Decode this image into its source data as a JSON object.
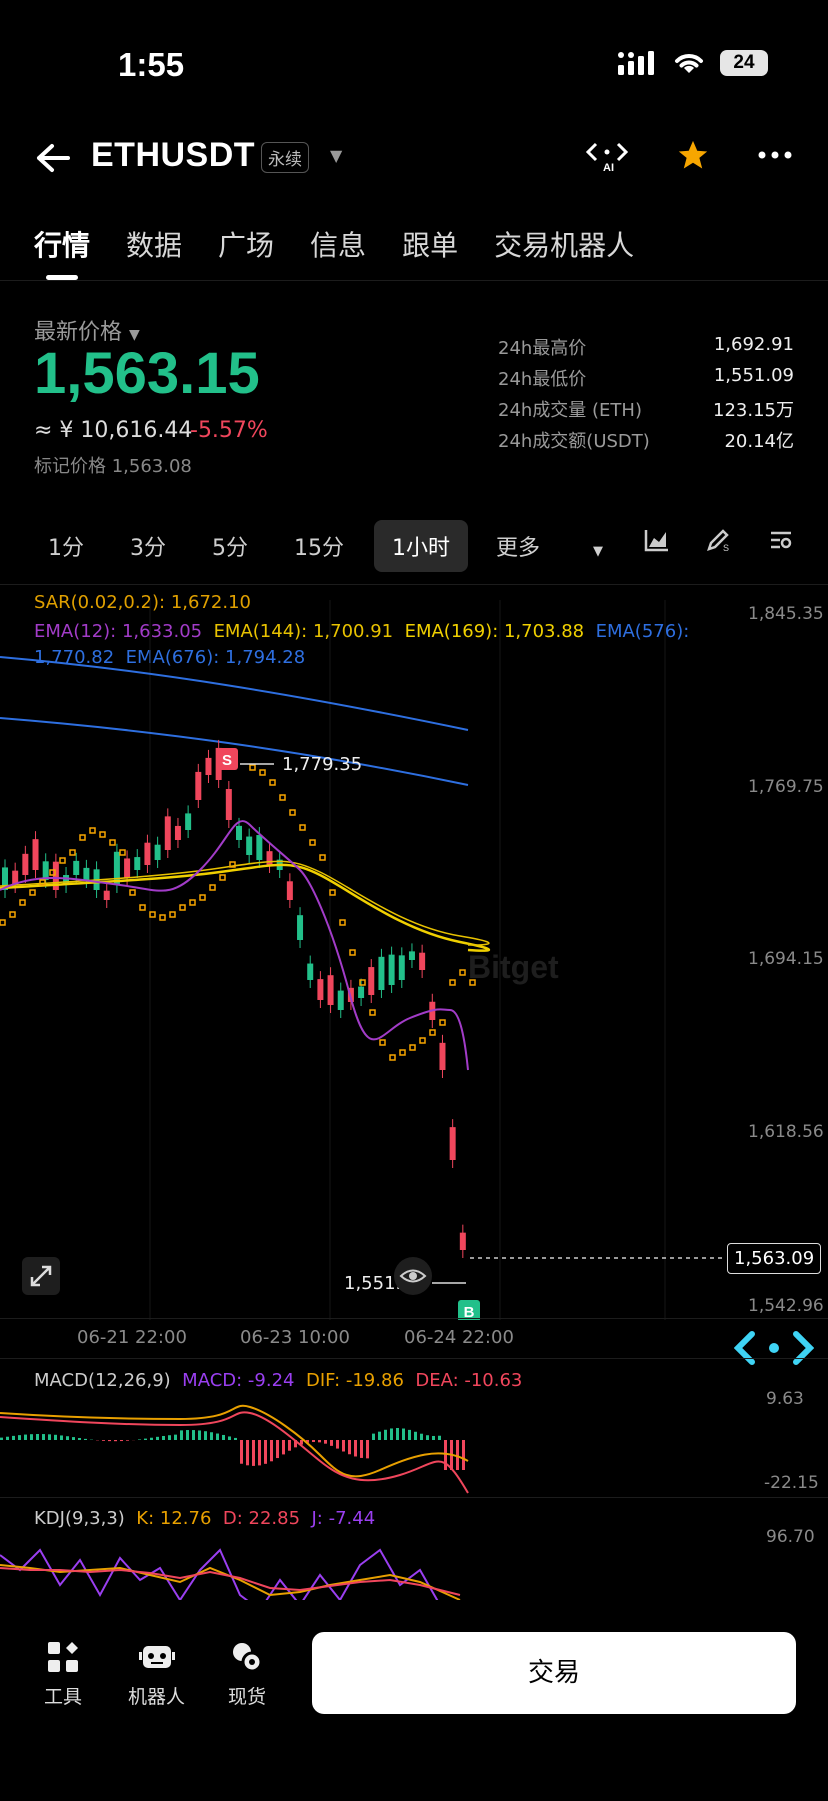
{
  "status": {
    "time": "1:55",
    "battery": "24"
  },
  "header": {
    "symbol": "ETHUSDT",
    "badge": "永续"
  },
  "tabs": [
    "行情",
    "数据",
    "广场",
    "信息",
    "跟单",
    "交易机器人"
  ],
  "price": {
    "label": "最新价格",
    "last": "1,563.15",
    "cny": "≈ ¥ 10,616.44",
    "change": "-5.57%",
    "mark": "标记价格 1,563.08",
    "change_color": "#f0465c",
    "up_color": "#22c08a"
  },
  "stats": [
    {
      "k": "24h最高价",
      "v": "1,692.91"
    },
    {
      "k": "24h最低价",
      "v": "1,551.09"
    },
    {
      "k": "24h成交量 (ETH)",
      "v": "123.15万"
    },
    {
      "k": "24h成交额(USDT)",
      "v": "20.14亿"
    }
  ],
  "intervals": [
    "1分",
    "3分",
    "5分",
    "15分",
    "1小时",
    "更多"
  ],
  "indicators": {
    "sar": "SAR(0.02,0.2): 1,672.10",
    "ema12": "EMA(12): 1,633.05",
    "ema144": "EMA(144): 1,700.91",
    "ema169": "EMA(169): 1,703.88",
    "ema576": "EMA(576):",
    "ema576_val": "1,770.82",
    "ema676": "EMA(676): 1,794.28"
  },
  "chart_data": {
    "type": "line",
    "price_axis": [
      "1,845.35",
      "1,769.75",
      "1,694.15",
      "1,618.56",
      "1,542.96"
    ],
    "x_labels": [
      "06-21 22:00",
      "06-23 10:00",
      "06-24 22:00"
    ],
    "high_marker": "1,779.35",
    "low_marker": "1,551.09",
    "current": "1,563.09",
    "sell_tag": "S",
    "buy_tag": "B",
    "ylim": [
      1542.96,
      1845.35
    ]
  },
  "macd": {
    "title": "MACD(12,26,9)",
    "macd": "MACD: -9.24",
    "dif": "DIF: -19.86",
    "dea": "DEA: -10.63",
    "axis": [
      "9.63",
      "-22.15"
    ]
  },
  "kdj": {
    "title": "KDJ(9,3,3)",
    "k": "K: 12.76",
    "d": "D: 22.85",
    "j": "J: -7.44",
    "axis": [
      "96.70"
    ]
  },
  "bottom": {
    "tools": "工具",
    "robot": "机器人",
    "spot": "现货",
    "trade": "交易"
  }
}
